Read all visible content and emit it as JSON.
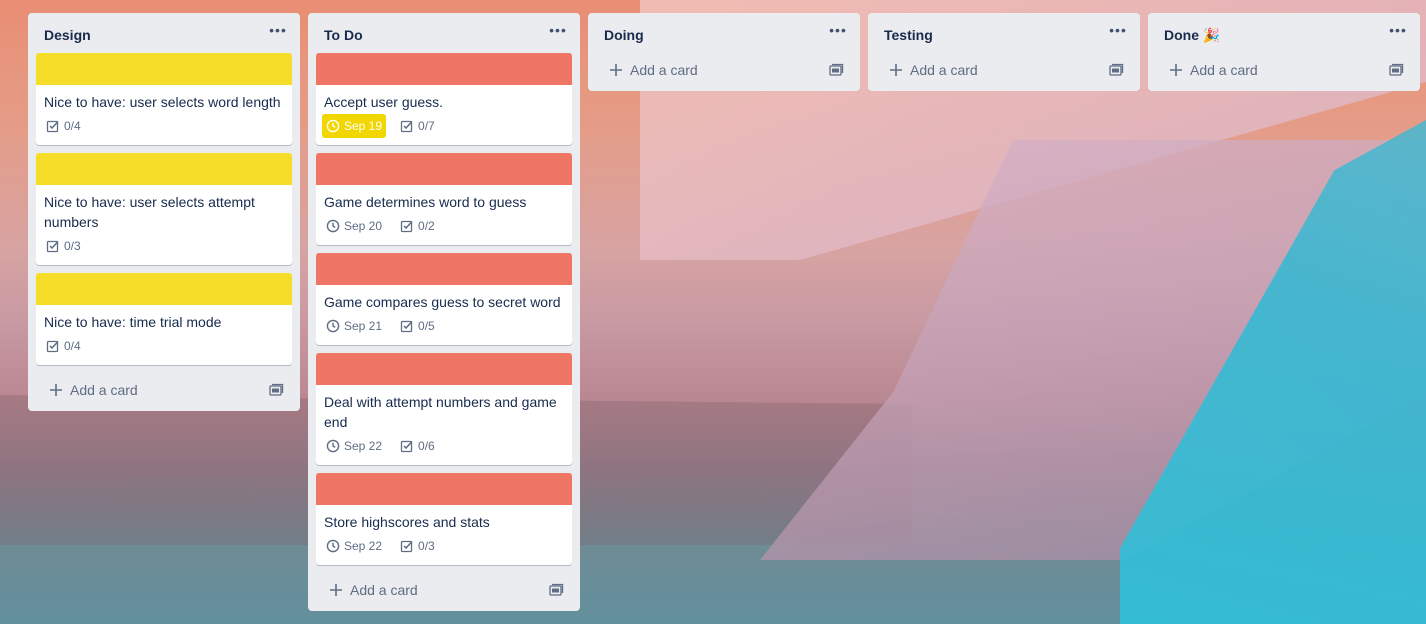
{
  "colors": {
    "yellow_label": "#f5dd29",
    "red_label": "#ef7564",
    "due_soon": "#f2d600",
    "list_bg": "#ebecf0"
  },
  "lists": [
    {
      "title": "Design",
      "add_card": "Add a card",
      "cards": [
        {
          "title": "Nice to have: user selects word length",
          "checklist": "0/4"
        },
        {
          "title": "Nice to have: user selects attempt numbers",
          "checklist": "0/3"
        },
        {
          "title": "Nice to have: time trial mode",
          "checklist": "0/4"
        }
      ]
    },
    {
      "title": "To Do",
      "add_card": "Add a card",
      "cards": [
        {
          "title": "Accept user guess.",
          "due": "Sep 19",
          "checklist": "0/7"
        },
        {
          "title": "Game determines word to guess",
          "due": "Sep 20",
          "checklist": "0/2"
        },
        {
          "title": "Game compares guess to secret word",
          "due": "Sep 21",
          "checklist": "0/5"
        },
        {
          "title": "Deal with attempt numbers and game end",
          "due": "Sep 22",
          "checklist": "0/6"
        },
        {
          "title": "Store highscores and stats",
          "due": "Sep 22",
          "checklist": "0/3"
        }
      ]
    },
    {
      "title": "Doing",
      "add_card": "Add a card",
      "cards": []
    },
    {
      "title": "Testing",
      "add_card": "Add a card",
      "cards": []
    },
    {
      "title": "Done 🎉",
      "add_card": "Add a card",
      "cards": []
    }
  ]
}
